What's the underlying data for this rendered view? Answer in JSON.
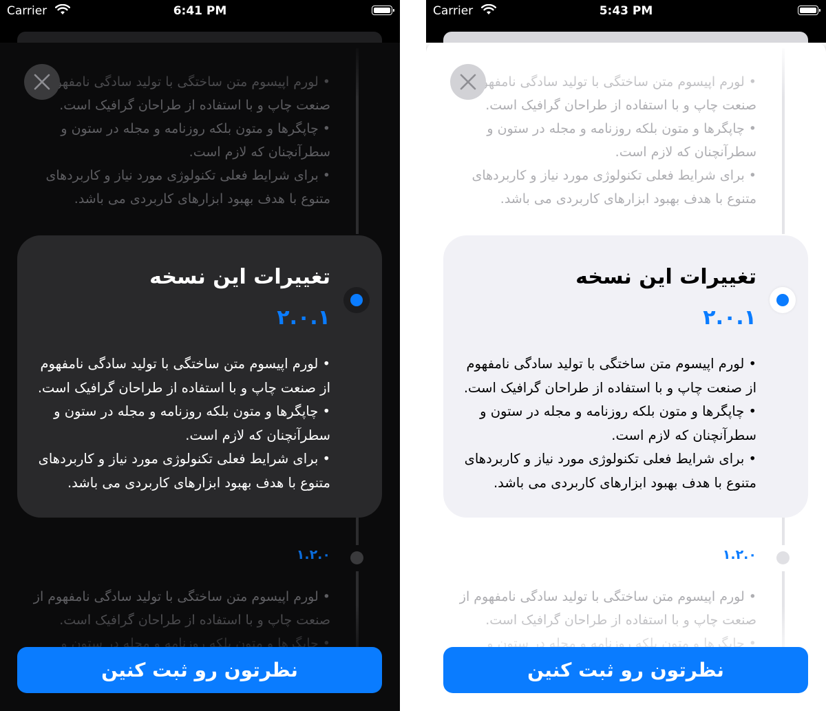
{
  "screens": [
    {
      "theme": "dark",
      "status": {
        "carrier": "Carrier",
        "time": "6:41 PM"
      }
    },
    {
      "theme": "light",
      "status": {
        "carrier": "Carrier",
        "time": "5:43 PM"
      }
    }
  ],
  "faded_notes": "• لورم اپیسوم متن ساختگی با تولید سادگی نامفهوم از\nصنعت چاپ و با استفاده از طراحان گرافیک است.\n• چاپگرها و متون بلکه روزنامه و مجله در ستون و\nسطرآنچنان که لازم است.\n• برای شرایط فعلی تکنولوژی مورد نیاز و کاربردهای\nمتنوع با هدف بهبود ابزارهای کاربردی می باشد.",
  "card": {
    "title": "تغییرات این نسخه",
    "version": "۲.۰.۱",
    "notes": "• لورم اپیسوم متن ساختگی با تولید سادگی نامفهوم\nاز صنعت چاپ و با استفاده از طراحان گرافیک است.\n• چاپگرها و متون بلکه روزنامه و مجله در ستون و\nسطرآنچنان که لازم است.\n• برای شرایط فعلی تکنولوژی مورد نیاز و کاربردهای\nمتنوع با هدف بهبود ابزارهای کاربردی می باشد."
  },
  "old_entry": {
    "version": "۱.۲.۰",
    "notes": "• لورم اپیسوم متن ساختگی با تولید سادگی نامفهوم از\nصنعت چاپ و با استفاده از طراحان گرافیک است.\n• چاپگرها و متون بلکه روزنامه و مجله در ستون و"
  },
  "submit_label": "نظرتون رو ثبت کنین",
  "colors": {
    "accent": "#0a7cff"
  },
  "icons": {
    "close": "close-icon",
    "wifi": "wifi-icon",
    "battery": "battery-icon"
  }
}
